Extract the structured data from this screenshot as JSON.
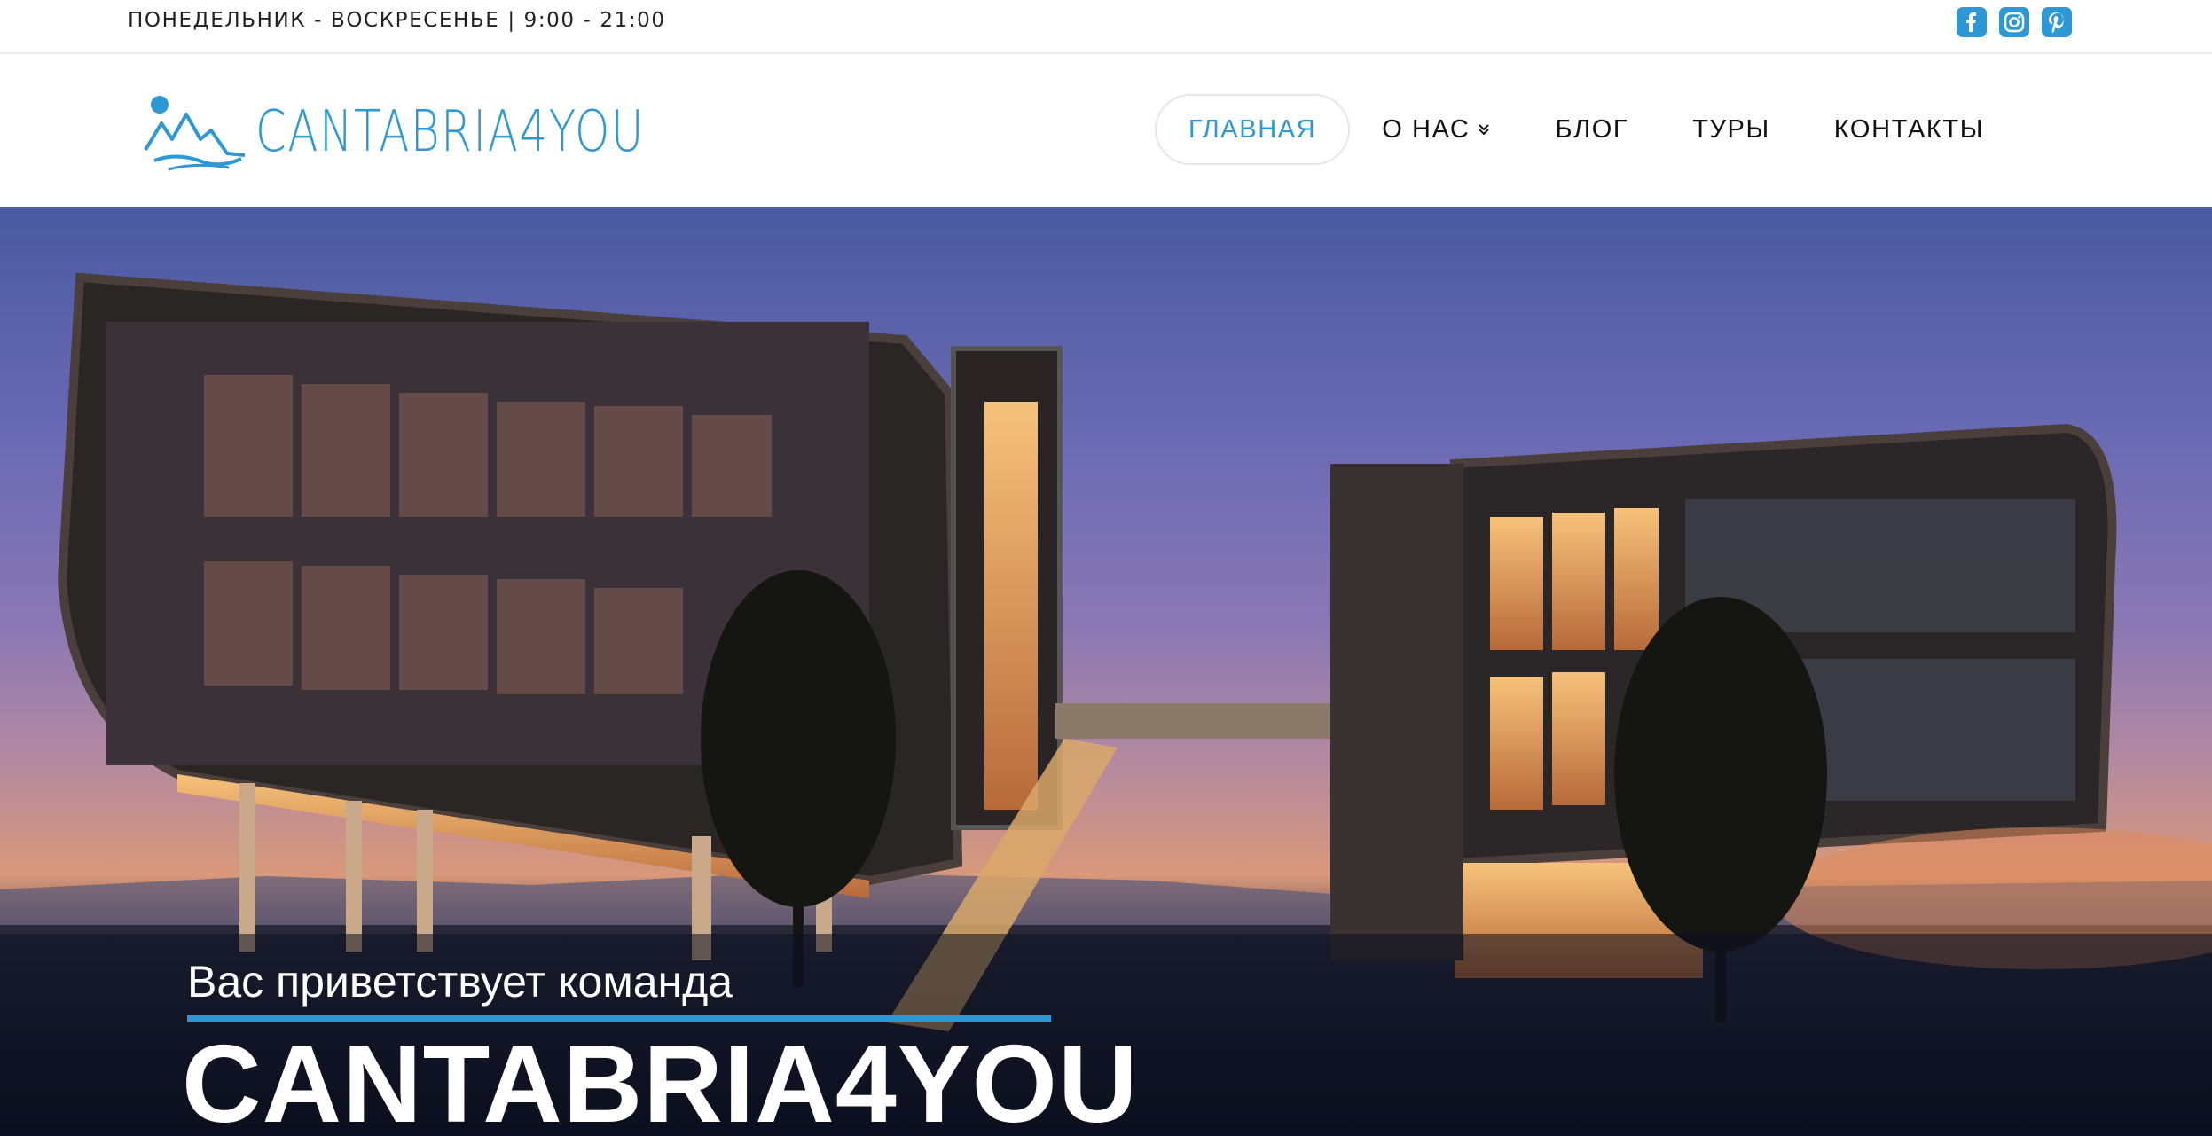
{
  "topbar": {
    "hours": "ПОНЕДЕЛЬНИК - ВОСКРЕСЕНЬЕ | 9:00 - 21:00",
    "social_icons": [
      "facebook-icon",
      "instagram-icon",
      "pinterest-icon"
    ]
  },
  "header": {
    "logo_text": "CANTABRIA4YOU",
    "nav": [
      {
        "label": "ГЛАВНАЯ",
        "active": true
      },
      {
        "label": "О НАС",
        "has_dropdown": true
      },
      {
        "label": "БЛОГ"
      },
      {
        "label": "ТУРЫ"
      },
      {
        "label": "КОНТАКТЫ"
      }
    ]
  },
  "hero": {
    "welcome": "Вас приветствует команда",
    "brand": "CANTABRIA4YOU"
  },
  "colors": {
    "accent": "#2d98d6",
    "text": "#111111"
  }
}
